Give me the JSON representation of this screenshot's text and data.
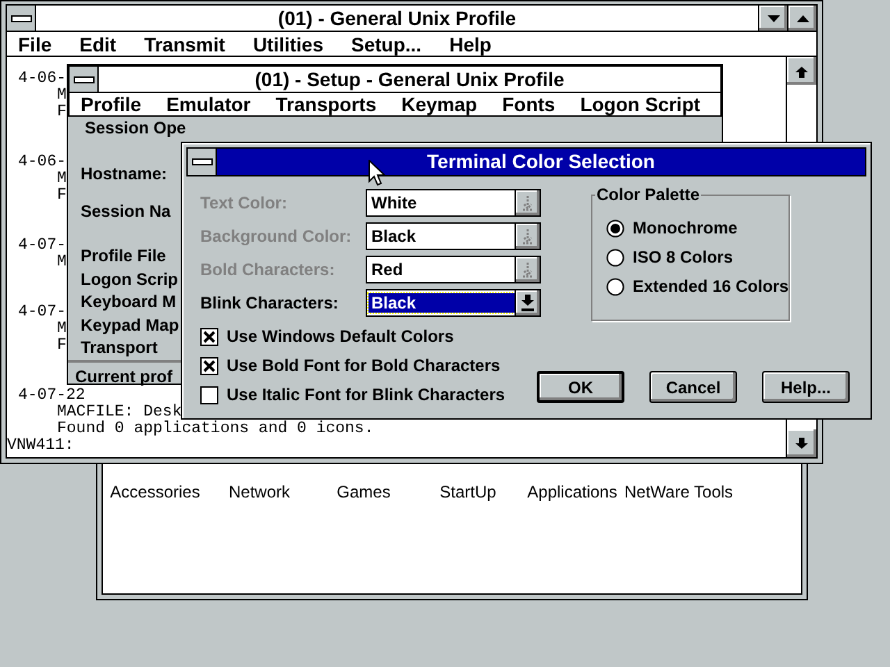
{
  "program_group": {
    "items": [
      "Accessories",
      "Network",
      "Games",
      "StartUp",
      "Applications",
      "NetWare Tools"
    ]
  },
  "terminal_window": {
    "title": "(01) - General Unix Profile",
    "menu": [
      "File",
      "Edit",
      "Transmit",
      "Utilities",
      "Setup...",
      "Help"
    ],
    "log": [
      {
        "date": "4-06-",
        "lines": [
          "M",
          "F"
        ]
      },
      {
        "date": "4-06-",
        "lines": [
          "M",
          "F"
        ]
      },
      {
        "date": "4-07-",
        "lines": [
          "M"
        ]
      },
      {
        "date": "4-07-",
        "lines": [
          "M",
          "F"
        ]
      },
      {
        "date": "4-07-22",
        "lines": [
          "MACFILE: Desk",
          "Found 0 applications and 0 icons."
        ]
      }
    ],
    "prompt": "VNW411:"
  },
  "setup_window": {
    "title": "(01) - Setup - General Unix Profile",
    "menu": [
      "Profile",
      "Emulator",
      "Transports",
      "Keymap",
      "Fonts",
      "Logon Script"
    ],
    "status": "Session Ope",
    "session_fields": [
      "Hostname:",
      "Session Na"
    ],
    "profile_fields": [
      "Profile File",
      "Logon Scrip",
      "Keyboard M",
      "Keypad Map",
      "Transport"
    ],
    "footer": "Current prof"
  },
  "color_dialog": {
    "title": "Terminal Color Selection",
    "color_fields": [
      {
        "label": "Text Color:",
        "value": "White",
        "disabled": true,
        "focused": false
      },
      {
        "label": "Background Color:",
        "value": "Black",
        "disabled": true,
        "focused": false
      },
      {
        "label": "Bold Characters:",
        "value": "Red",
        "disabled": true,
        "focused": false
      },
      {
        "label": "Blink Characters:",
        "value": "Black",
        "disabled": false,
        "focused": true
      }
    ],
    "palette": {
      "title": "Color Palette",
      "options": [
        {
          "label": "Monochrome",
          "selected": true
        },
        {
          "label": "ISO 8 Colors",
          "selected": false
        },
        {
          "label": "Extended 16 Colors",
          "selected": false
        }
      ]
    },
    "checkboxes": [
      {
        "label": "Use Windows Default Colors",
        "checked": true
      },
      {
        "label": "Use Bold Font for Bold Characters",
        "checked": true
      },
      {
        "label": "Use Italic Font for Blink Characters",
        "checked": false
      }
    ],
    "buttons": [
      {
        "label": "OK",
        "default": true
      },
      {
        "label": "Cancel",
        "default": false
      },
      {
        "label": "Help...",
        "default": false
      }
    ]
  }
}
